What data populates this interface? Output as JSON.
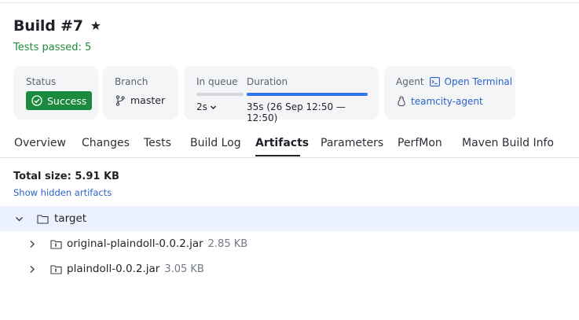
{
  "header": {
    "title": "Build #7",
    "tests_status": "Tests passed: 5"
  },
  "cards": {
    "status": {
      "label": "Status",
      "value": "Success",
      "color": "#1c8a3e"
    },
    "branch": {
      "label": "Branch",
      "value": "master"
    },
    "queue": {
      "label": "In queue",
      "value": "2s"
    },
    "duration": {
      "label": "Duration",
      "value": "35s (26 Sep 12:50 — 12:50)"
    },
    "agent": {
      "label": "Agent",
      "terminal_link": "Open Terminal",
      "name": "teamcity-agent"
    }
  },
  "tabs": [
    {
      "label": "Overview"
    },
    {
      "label": "Changes"
    },
    {
      "label": "Tests"
    },
    {
      "label": "Build Log"
    },
    {
      "label": "Artifacts",
      "active": true
    },
    {
      "label": "Parameters"
    },
    {
      "label": "PerfMon"
    },
    {
      "label": "Maven Build Info"
    }
  ],
  "artifacts": {
    "total_size": "Total size: 5.91 KB",
    "show_hidden": "Show hidden artifacts",
    "tree": {
      "folder": "target",
      "files": [
        {
          "name": "original-plaindoll-0.0.2.jar",
          "size": "2.85 KB"
        },
        {
          "name": "plaindoll-0.0.2.jar",
          "size": "3.05 KB"
        }
      ]
    }
  },
  "icons": {
    "star": "star-icon",
    "success": "check-circle-icon",
    "branch": "branch-icon",
    "terminal": "terminal-icon",
    "agent": "linux-icon",
    "folder": "folder-icon",
    "archive": "archive-icon"
  }
}
